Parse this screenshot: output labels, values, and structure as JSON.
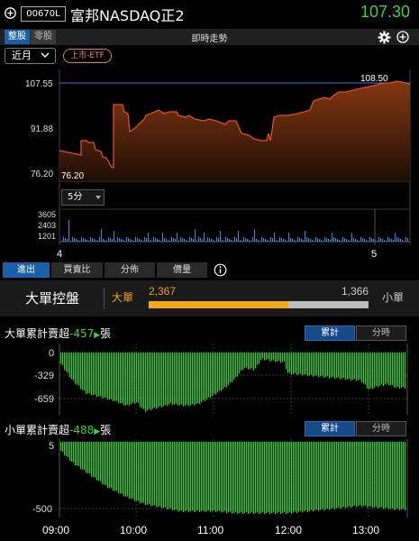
{
  "header": {
    "code": "00670L",
    "name": "富邦NASDAQ正2",
    "price": "107.30",
    "price_color": "#3bd23b"
  },
  "tabs": {
    "board_lot": "整股",
    "odd_lot": "零股",
    "title": "即時走勢"
  },
  "toolbar": {
    "period": "近月",
    "listing_badge": "上市-ETF",
    "interval": "5分"
  },
  "price_chart": {
    "y_labels": [
      "107.55",
      "91.88",
      "76.20"
    ],
    "last_label": "108.50",
    "low_label": "76.20",
    "vol_labels": [
      "3605",
      "2403",
      "1201"
    ],
    "x_labels": [
      "4",
      "5"
    ]
  },
  "sub_tabs": [
    "進出",
    "買賣比",
    "分佈",
    "價量"
  ],
  "block_trades": {
    "title": "大單控盤",
    "big_label": "大單",
    "big_value": "2,367",
    "small_value": "1,366",
    "small_label": "小單",
    "big_ratio": 0.634
  },
  "big_cum": {
    "label": "大單累計賣超",
    "value": "-457",
    "unit": "張",
    "y_labels": [
      "0",
      "-329",
      "-659"
    ]
  },
  "small_cum": {
    "label": "小單累計賣超",
    "value": "-488",
    "unit": "張",
    "y_labels": [
      "5",
      "-500"
    ]
  },
  "toggles": {
    "cumulative": "累計",
    "per_period": "分時"
  },
  "time_axis": [
    "09:00",
    "10:00",
    "11:00",
    "12:00",
    "13:00"
  ],
  "colors": {
    "accent": "#1b5fa8",
    "up": "#e0401a",
    "down": "#3bd23b",
    "orange": "#f0a020"
  }
}
